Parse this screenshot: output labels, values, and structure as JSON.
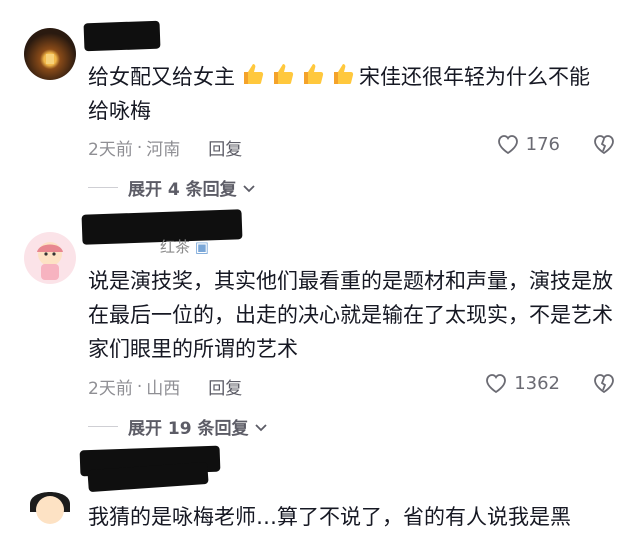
{
  "comments": [
    {
      "text_line1": "给女配又给女主",
      "thumbs_emoji": "👍",
      "thumbs_count_icon": "thumbs-up-emoji",
      "text_line1_tail": "宋佳还很年轻为什么不能",
      "text_line2": "给咏梅",
      "time": "2天前",
      "sep": "·",
      "location": "河南",
      "reply_label": "回复",
      "likes": "176",
      "expand_label": "展开 4 条回复"
    },
    {
      "name_tail": "红茶",
      "text": "说是演技奖，其实他们最看重的是题材和声量，演技是放在最后一位的，出走的决心就是输在了太现实，不是艺术家们眼里的所谓的艺术",
      "time": "2天前",
      "sep": "·",
      "location": "山西",
      "reply_label": "回复",
      "likes": "1362",
      "expand_label": "展开 19 条回复"
    },
    {
      "text": "我猜的是咏梅老师…算了不说了，省的有人说我是黑"
    }
  ],
  "colors": {
    "text": "#161823",
    "meta": "#8f8f94",
    "redaction": "#0f0f0f"
  }
}
